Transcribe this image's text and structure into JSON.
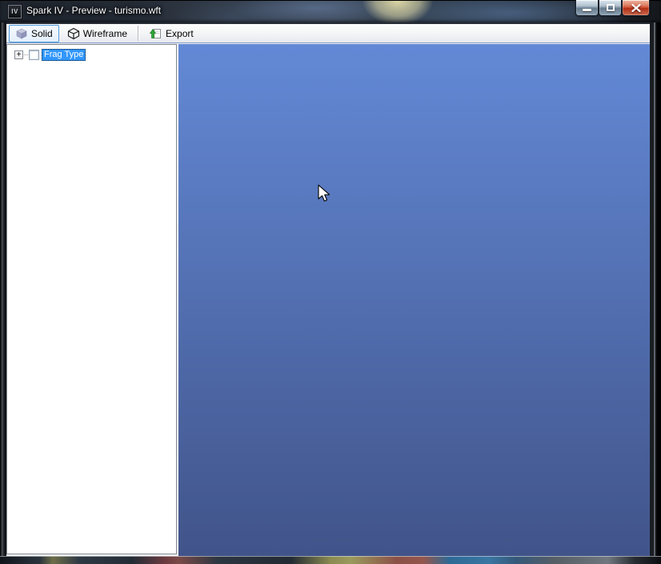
{
  "window": {
    "title": "Spark IV - Preview - turismo.wft",
    "app_icon_text": "IV"
  },
  "toolbar": {
    "solid_label": "Solid",
    "wireframe_label": "Wireframe",
    "export_label": "Export"
  },
  "tree": {
    "expander_glyph": "+",
    "root_label": "Frag Type",
    "root_checkbox_checked": false,
    "root_selected": true
  },
  "viewport": {
    "gradient_top": "#6389d6",
    "gradient_bottom": "#41548a"
  },
  "colors": {
    "selection_blue": "#3197fd",
    "toolbar_checked_border": "#4e9bdf",
    "close_button_red": "#d4573a",
    "solid_cube_top": "#c7cade",
    "solid_cube_left": "#a2a7c8",
    "solid_cube_right": "#8f94ba",
    "export_arrow_green": "#2fa838"
  }
}
